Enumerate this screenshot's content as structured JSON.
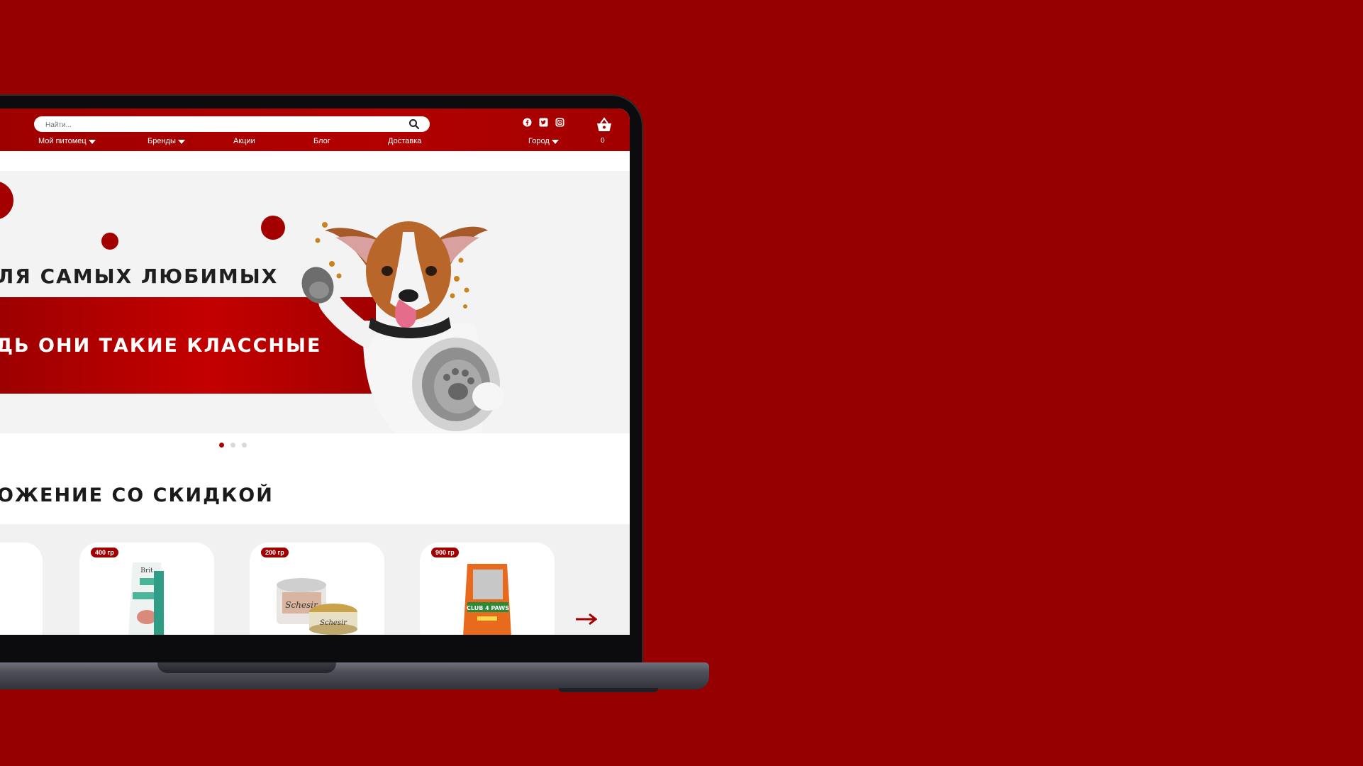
{
  "colors": {
    "background": "#960000",
    "accent": "#a40000",
    "header": "#b30000"
  },
  "header": {
    "search": {
      "placeholder": "Найти..."
    },
    "nav": [
      {
        "label": "Мой питомец",
        "dropdown": true
      },
      {
        "label": "Бренды",
        "dropdown": true
      },
      {
        "label": "Акции",
        "dropdown": false
      },
      {
        "label": "Блог",
        "dropdown": false
      },
      {
        "label": "Доставка",
        "dropdown": false
      }
    ],
    "city": {
      "label": "Город",
      "dropdown": true
    },
    "social": [
      "facebook-icon",
      "twitter-icon",
      "instagram-icon"
    ],
    "cart": {
      "icon": "basket-icon",
      "count": "0"
    }
  },
  "hero": {
    "line1": "ЛЯ САМЫХ ЛЮБИМЫХ",
    "line2": "ДЬ ОНИ ТАКИЕ КЛАССНЫЕ",
    "slides_total": 3,
    "active_slide": 1
  },
  "section": {
    "title": "ОЖЕНИЕ СО СКИДКОЙ"
  },
  "products": [
    {
      "badge": "400 гр",
      "product": "Brit Care Sterilized"
    },
    {
      "badge": "200 гр",
      "product": "Schesir"
    },
    {
      "badge": "900 гр",
      "product": "Club 4 Paws"
    }
  ]
}
